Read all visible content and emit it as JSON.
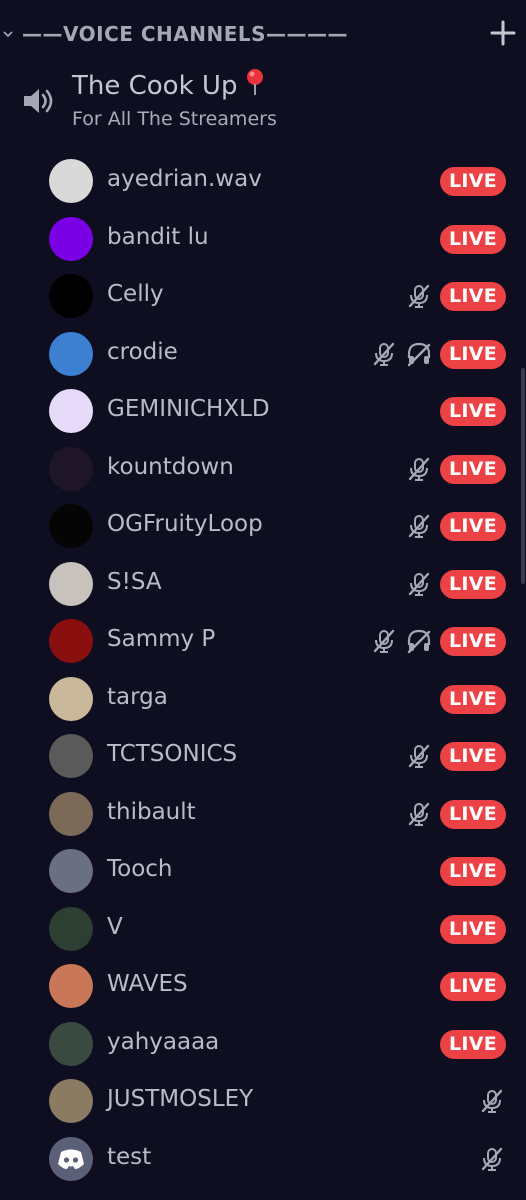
{
  "header": {
    "title": "——VOICE CHANNELS————"
  },
  "channel": {
    "name": "The Cook Up",
    "description": "For All The Streamers"
  },
  "members": [
    {
      "name": "ayedrian.wav",
      "live": "LIVE",
      "mute": false,
      "deaf": false,
      "avatar": "#d9d9d9"
    },
    {
      "name": "bandit lu",
      "live": "LIVE",
      "mute": false,
      "deaf": false,
      "avatar": "#7a00e6"
    },
    {
      "name": "Celly",
      "live": "LIVE",
      "mute": true,
      "deaf": false,
      "avatar": "#000000"
    },
    {
      "name": "crodie",
      "live": "LIVE",
      "mute": true,
      "deaf": true,
      "avatar": "#3d7fd1"
    },
    {
      "name": "GEMINICHXLD",
      "live": "LIVE",
      "mute": false,
      "deaf": false,
      "avatar": "#e6dcfa"
    },
    {
      "name": "kountdown",
      "live": "LIVE",
      "mute": true,
      "deaf": false,
      "avatar": "#1e1528"
    },
    {
      "name": "OGFruityLoop",
      "live": "LIVE",
      "mute": true,
      "deaf": false,
      "avatar": "#050505"
    },
    {
      "name": "S!SA",
      "live": "LIVE",
      "mute": true,
      "deaf": false,
      "avatar": "#c8c2bc"
    },
    {
      "name": "Sammy P",
      "live": "LIVE",
      "mute": true,
      "deaf": true,
      "avatar": "#8a1010"
    },
    {
      "name": "targa",
      "live": "LIVE",
      "mute": false,
      "deaf": false,
      "avatar": "#c9b89a"
    },
    {
      "name": "TCTSONICS",
      "live": "LIVE",
      "mute": true,
      "deaf": false,
      "avatar": "#5a5a5a"
    },
    {
      "name": "thibault",
      "live": "LIVE",
      "mute": true,
      "deaf": false,
      "avatar": "#7b6a58"
    },
    {
      "name": "Tooch",
      "live": "LIVE",
      "mute": false,
      "deaf": false,
      "avatar": "#6a7080"
    },
    {
      "name": "V",
      "live": "LIVE",
      "mute": false,
      "deaf": false,
      "avatar": "#2c3f32"
    },
    {
      "name": "WAVES",
      "live": "LIVE",
      "mute": false,
      "deaf": false,
      "avatar": "#c87858"
    },
    {
      "name": "yahyaaaa",
      "live": "LIVE",
      "mute": false,
      "deaf": false,
      "avatar": "#3a4a40"
    },
    {
      "name": "JUSTMOSLEY",
      "live": "",
      "mute": true,
      "deaf": false,
      "avatar": "#8a7b62"
    },
    {
      "name": "test",
      "live": "",
      "mute": true,
      "deaf": false,
      "avatar": "#5b6078"
    }
  ],
  "colors": {
    "background": "#0f0e20",
    "live": "#ed4245",
    "text": "#b8bcc6",
    "icon": "#a4a8b4"
  },
  "icons": {
    "mute": "mic-off-icon",
    "deaf": "headphones-off-icon",
    "speaker": "speaker-icon",
    "pin": "pushpin-icon",
    "add": "plus-icon",
    "collapse": "chevron-down-icon"
  }
}
